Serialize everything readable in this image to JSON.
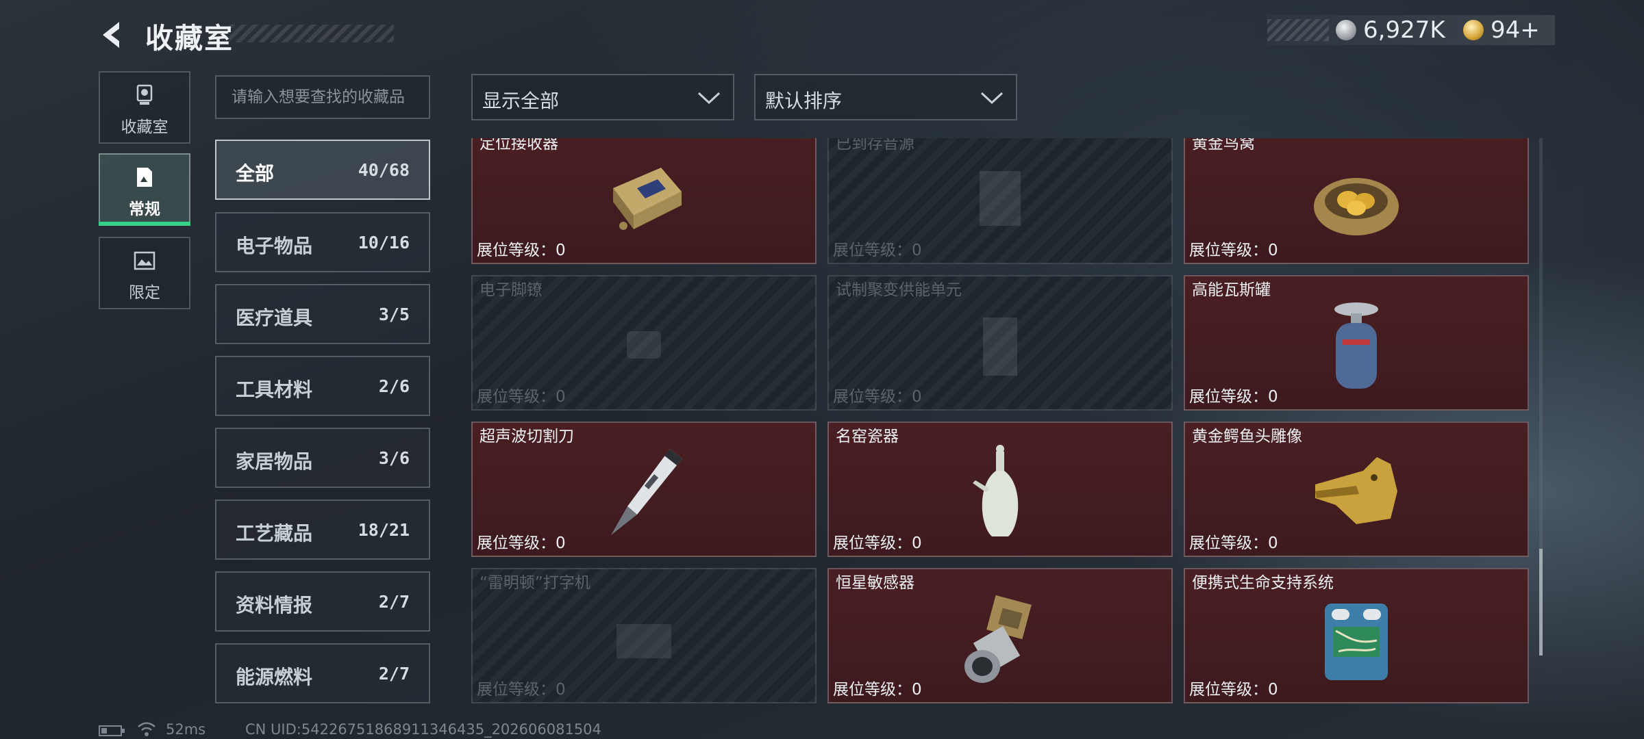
{
  "header": {
    "title": "收藏室",
    "currency_1": "6,927K",
    "currency_2": "94+"
  },
  "side_tabs": [
    {
      "label": "收藏室",
      "icon": "trophy-icon",
      "active": false
    },
    {
      "label": "常规",
      "icon": "document-icon",
      "active": true
    },
    {
      "label": "限定",
      "icon": "image-icon",
      "active": false
    }
  ],
  "search": {
    "placeholder": "请输入想要查找的收藏品"
  },
  "categories": [
    {
      "name": "全部",
      "count": "40/68",
      "active": true
    },
    {
      "name": "电子物品",
      "count": "10/16"
    },
    {
      "name": "医疗道具",
      "count": "3/5"
    },
    {
      "name": "工具材料",
      "count": "2/6"
    },
    {
      "name": "家居物品",
      "count": "3/6"
    },
    {
      "name": "工艺藏品",
      "count": "18/21"
    },
    {
      "name": "资料情报",
      "count": "2/7"
    },
    {
      "name": "能源燃料",
      "count": "2/7"
    }
  ],
  "filters": {
    "display": "显示全部",
    "sort": "默认排序"
  },
  "level_label": "展位等级：0",
  "items": [
    {
      "name": "定位接收器",
      "owned": true,
      "icon": "receiver-icon"
    },
    {
      "name": "已到存音源",
      "owned": false,
      "icon": "audio-device-icon"
    },
    {
      "name": "黄金鸟窝",
      "owned": true,
      "icon": "golden-nest-icon"
    },
    {
      "name": "电子脚镣",
      "owned": false,
      "icon": "ankle-monitor-icon"
    },
    {
      "name": "试制聚变供能单元",
      "owned": false,
      "icon": "fusion-unit-icon"
    },
    {
      "name": "高能瓦斯罐",
      "owned": true,
      "icon": "gas-tank-icon"
    },
    {
      "name": "超声波切割刀",
      "owned": true,
      "icon": "cutter-icon"
    },
    {
      "name": "名窑瓷器",
      "owned": true,
      "icon": "porcelain-vase-icon"
    },
    {
      "name": "黄金鳄鱼头雕像",
      "owned": true,
      "icon": "gold-crocodile-icon"
    },
    {
      "name": "“雷明顿”打字机",
      "owned": false,
      "icon": "typewriter-icon"
    },
    {
      "name": "恒星敏感器",
      "owned": true,
      "icon": "star-sensor-icon"
    },
    {
      "name": "便携式生命支持系统",
      "owned": true,
      "icon": "life-support-icon"
    }
  ],
  "status_bar": {
    "ping": "52ms",
    "uid": "CN UID:5422675186891134643​5_202606081504"
  }
}
